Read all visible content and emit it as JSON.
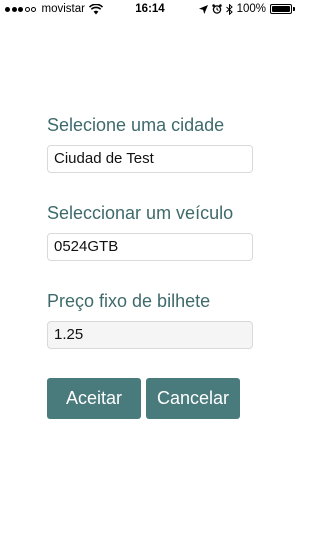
{
  "status_bar": {
    "carrier": "movistar",
    "time": "16:14",
    "battery": "100%",
    "battery_level": 1.0,
    "signal_bars": 3,
    "signal_max": 5
  },
  "form": {
    "city": {
      "label": "Selecione uma cidade",
      "value": "Ciudad de Test"
    },
    "vehicle": {
      "label": "Seleccionar um veículo",
      "value": "0524GTB"
    },
    "price": {
      "label": "Preço fixo de bilhete",
      "value": "1.25"
    }
  },
  "actions": {
    "accept_label": "Aceitar",
    "cancel_label": "Cancelar"
  },
  "colors": {
    "accent": "#4a7b7c",
    "label": "#3f6a6b"
  }
}
